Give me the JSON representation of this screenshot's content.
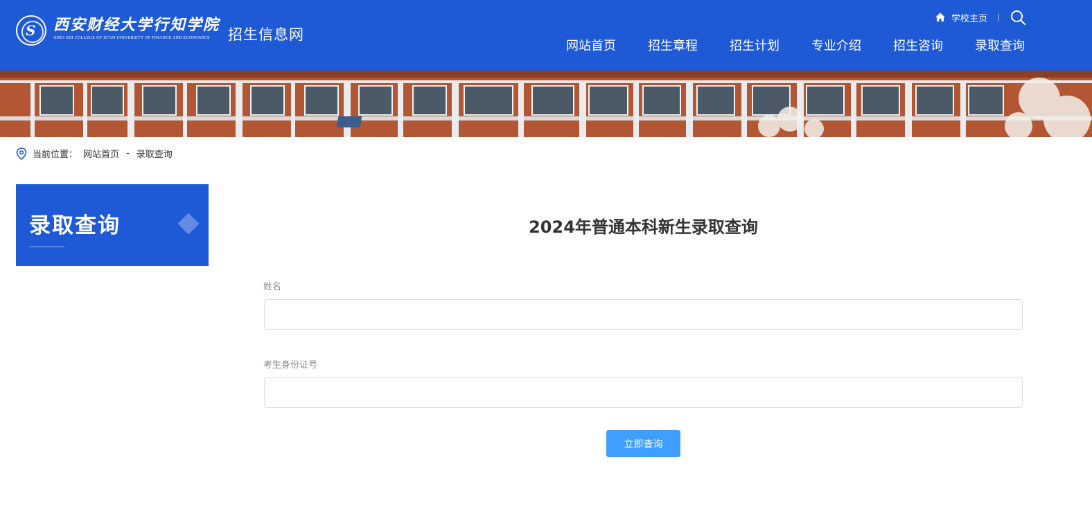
{
  "header": {
    "logo_cn": "西安财经大学行知学院",
    "logo_en": "XING ZHI COLLEGE OF XI'AN UNIVERSITY OF FINANCE AND ECONOMICS",
    "site_name": "招生信息网",
    "school_home": "学校主页",
    "home_icon": "home-icon",
    "search_icon": "search-icon",
    "nav": [
      "网站首页",
      "招生章程",
      "招生计划",
      "专业介绍",
      "招生咨询",
      "录取查询"
    ],
    "bg_color": "#1f5ad6"
  },
  "breadcrumb": {
    "label": "当前位置：",
    "items": [
      "网站首页",
      "录取查询"
    ],
    "separator": "-"
  },
  "sidebar": {
    "title": "录取查询"
  },
  "form": {
    "title": "2024年普通本科新生录取查询",
    "name_label": "姓名",
    "name_value": "",
    "id_label": "考生身份证号",
    "id_value": "",
    "submit_label": "立即查询",
    "button_color": "#409eff"
  }
}
